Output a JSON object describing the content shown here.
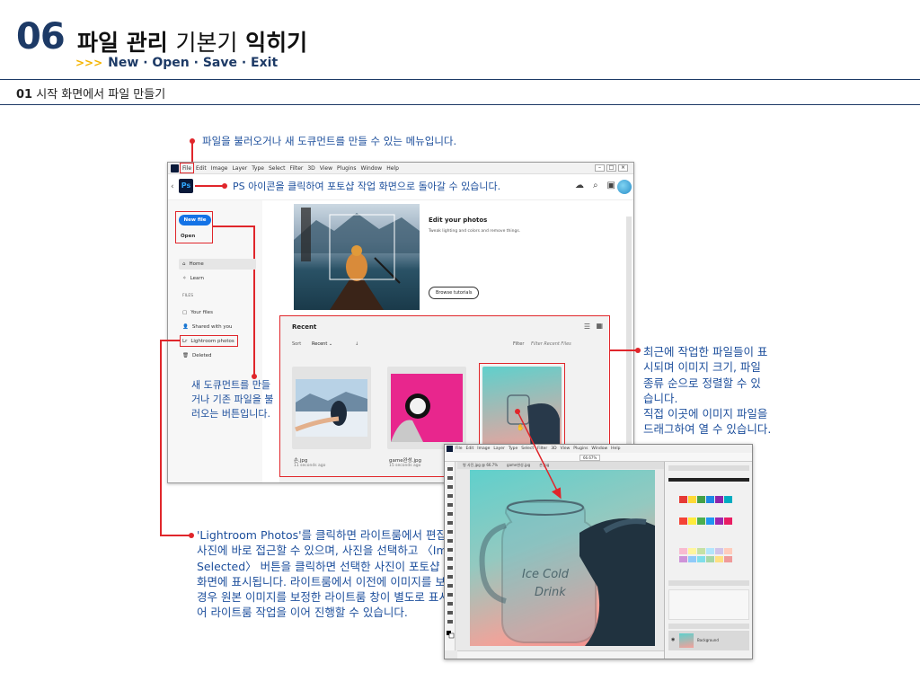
{
  "header": {
    "chapter_num": "06",
    "title_bold1": "파일 관리",
    "title_light": "기본기",
    "title_bold2": "익히기",
    "sub_arrows": ">>>",
    "subtitle": "New · Open · Save · Exit"
  },
  "section": {
    "num": "01",
    "title": "시작 화면에서 파일 만들기"
  },
  "callouts": {
    "file_menu": "파일을 불러오거나 새 도큐먼트를 만들 수 있는 메뉴입니다.",
    "ps_icon": "PS 아이콘을 클릭하여 포토샵 작업 화면으로 돌아갈 수 있습니다.",
    "new_open": [
      "새 도큐먼트를 만들",
      "거나 기존 파일을 불",
      "러오는 버튼입니다."
    ],
    "recent": [
      "최근에 작업한 파일들이 표",
      "시되며 이미지 크기, 파일",
      "종류 순으로 정렬할 수 있",
      "습니다.",
      "직접 이곳에 이미지 파일을",
      "드래그하여 열 수 있습니다."
    ],
    "lightroom": [
      "'Lightroom Photos'를 클릭하면 라이트룸에서 편집하던",
      "사진에 바로 접근할 수 있으며, 사진을 선택하고 〈Import",
      "Selected〉 버튼을 클릭하면 선택한 사진이 포토샵 작업",
      "화면에 표시됩니다. 라이트룸에서 이전에 이미지를 보정한",
      "경우 원본 이미지를 보정한 라이트룸 창이 별도로 표시되",
      "어 라이트룸 작업을 이어 진행할 수 있습니다."
    ]
  },
  "ps_home": {
    "menu": [
      "File",
      "Edit",
      "Image",
      "Layer",
      "Type",
      "Select",
      "Filter",
      "3D",
      "View",
      "Plugins",
      "Window",
      "Help"
    ],
    "logo": "Ps",
    "new_file": "New file",
    "open": "Open",
    "nav": [
      "Home",
      "Learn"
    ],
    "files_label": "FILES",
    "files": [
      "Your files",
      "Shared with you",
      "Lightroom photos",
      "Deleted"
    ],
    "hero_title": "Edit your photos",
    "hero_desc": "Tweak lighting and colors and remove things.",
    "hero_button": "Browse tutorials",
    "recent_title": "Recent",
    "sort_label": "Sort",
    "sort_value": "Recent",
    "filter_label": "Filter",
    "filter_placeholder": "Filter Recent Files",
    "recent_files": [
      {
        "name": "손.jpg",
        "time": "11 seconds ago"
      },
      {
        "name": "game완성.jpg",
        "time": "15 seconds ago"
      }
    ]
  },
  "ps_editor": {
    "menu": [
      "Ps",
      "File",
      "Edit",
      "Image",
      "Layer",
      "Type",
      "Select",
      "Filter",
      "3D",
      "View",
      "Plugins",
      "Window",
      "Help"
    ],
    "tabs": [
      "병 사진.jpg @ 66.7%",
      "game완성.jpg",
      "손.jpg"
    ],
    "zoom": "66.67%",
    "layer_name": "Background"
  }
}
